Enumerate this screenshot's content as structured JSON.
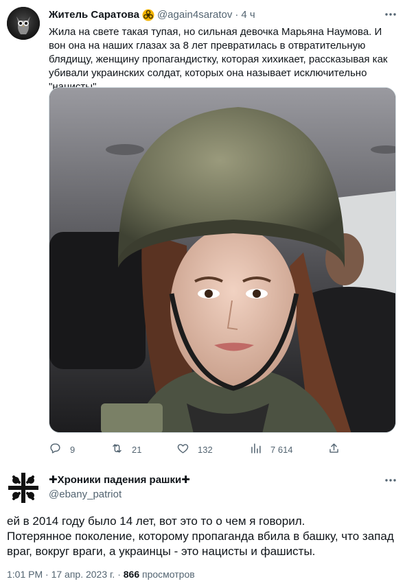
{
  "quoted_tweet": {
    "author_name": "Житель Саратова",
    "badge_icon": "biohazard-badge-icon",
    "handle": "@again4saratov",
    "separator": "·",
    "time": "4 ч",
    "text": "Жила на свете такая тупая, но сильная девочка Марьяна Наумова. И вон она на наших глазах за 8 лет превратилась в отвратительную блядищу, женщину пропагандистку, которая хихикает, рассказывая как убивали украинских солдат, которых она называет исключительно \"нацисты\".",
    "media_icon": "photo-woman-in-helmet",
    "actions": {
      "replies": "9",
      "retweets": "21",
      "likes": "132",
      "views": "7 614"
    }
  },
  "reply_tweet": {
    "author_name": "✚Хроники падения рашки✚",
    "handle": "@ebany_patriot",
    "text": "ей в 2014 году было 14 лет, вот это то о чем я говорил.\nПотерянное поколение, которому пропаганда вбила в башку, что запад враг, вокруг враги, а украинцы - это нацисты и фашисты.",
    "time": "1:01 PM",
    "separator": "·",
    "date": "17 апр. 2023 г.",
    "views_count": "866",
    "views_label": "просмотров"
  },
  "colors": {
    "text": "#0f1419",
    "muted": "#536471",
    "badge": "#f4b400",
    "border": "#cfd9de"
  }
}
